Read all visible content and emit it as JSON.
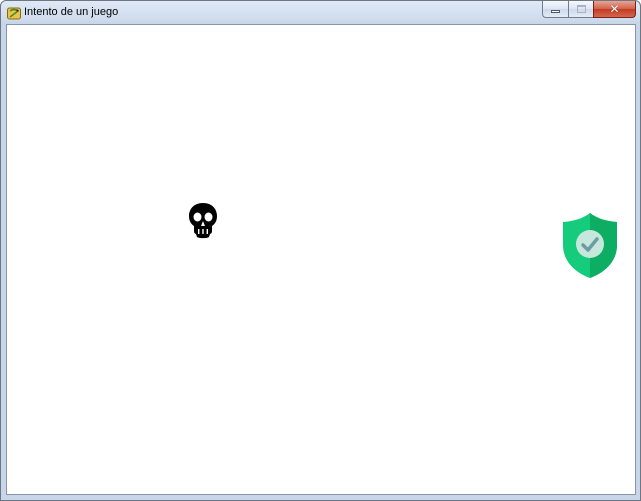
{
  "window": {
    "title": "Intento de un juego",
    "controls": {
      "minimize_icon": "minimize-icon",
      "maximize_icon": "maximize-icon",
      "close_glyph": "✕"
    },
    "icon": "pygame-snake-icon"
  },
  "game": {
    "background_color": "#ffffff",
    "sprites": [
      {
        "name": "skull",
        "icon": "skull-icon",
        "color": "#000000"
      },
      {
        "name": "shield",
        "icon": "shield-check-icon",
        "colors": [
          "#15cc7c",
          "#0dae63",
          "#c6e8dc",
          "#6f9ba6"
        ]
      }
    ]
  }
}
